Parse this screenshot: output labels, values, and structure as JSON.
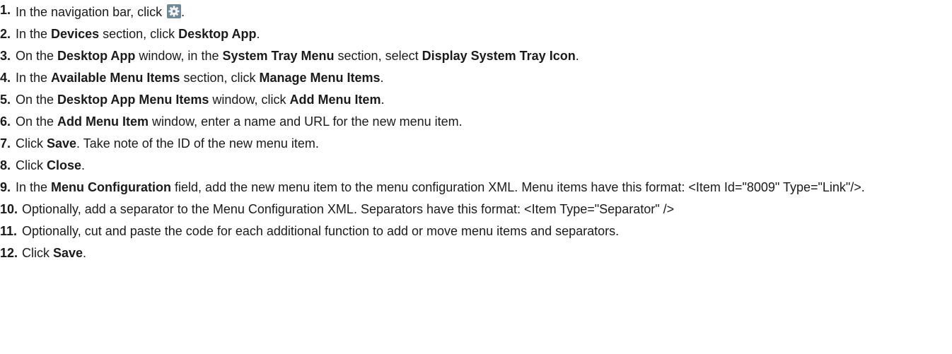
{
  "steps": [
    {
      "num": "1.",
      "segments": [
        {
          "text": "In the navigation bar, click "
        },
        {
          "icon": "gear-icon"
        },
        {
          "text": "."
        }
      ]
    },
    {
      "num": "2.",
      "segments": [
        {
          "text": "In the "
        },
        {
          "text": "Devices",
          "bold": true
        },
        {
          "text": " section, click "
        },
        {
          "text": "Desktop App",
          "bold": true
        },
        {
          "text": "."
        }
      ]
    },
    {
      "num": "3.",
      "segments": [
        {
          "text": "On the "
        },
        {
          "text": "Desktop App",
          "bold": true
        },
        {
          "text": " window, in the "
        },
        {
          "text": "System Tray Menu",
          "bold": true
        },
        {
          "text": " section, select "
        },
        {
          "text": "Display System Tray Icon",
          "bold": true
        },
        {
          "text": "."
        }
      ]
    },
    {
      "num": "4.",
      "segments": [
        {
          "text": "In the "
        },
        {
          "text": "Available Menu Items",
          "bold": true
        },
        {
          "text": " section, click "
        },
        {
          "text": "Manage Menu Items",
          "bold": true
        },
        {
          "text": "."
        }
      ]
    },
    {
      "num": "5.",
      "segments": [
        {
          "text": "On the "
        },
        {
          "text": "Desktop App Menu Items",
          "bold": true
        },
        {
          "text": " window, click "
        },
        {
          "text": "Add Menu Item",
          "bold": true
        },
        {
          "text": "."
        }
      ]
    },
    {
      "num": "6.",
      "segments": [
        {
          "text": "On the "
        },
        {
          "text": "Add Menu Item",
          "bold": true
        },
        {
          "text": " window, enter a name and URL for the new menu item."
        }
      ]
    },
    {
      "num": "7.",
      "segments": [
        {
          "text": "Click "
        },
        {
          "text": "Save",
          "bold": true
        },
        {
          "text": ". Take note of the ID of the new menu item."
        }
      ]
    },
    {
      "num": "8.",
      "segments": [
        {
          "text": "Click "
        },
        {
          "text": "Close",
          "bold": true
        },
        {
          "text": "."
        }
      ]
    },
    {
      "num": "9.",
      "wrap": true,
      "segments": [
        {
          "text": "In the "
        },
        {
          "text": "Menu Configuration",
          "bold": true
        },
        {
          "text": " field, add the new menu item to the menu configuration XML. Menu items have this format: <Item Id=\"8009\" Type=\"Link\"/>."
        }
      ]
    },
    {
      "num": "10.",
      "wrap": true,
      "segments": [
        {
          "text": "Optionally, add a separator to the Menu Configuration XML. Separators have this format: <Item Type=\"Separator\" />"
        }
      ]
    },
    {
      "num": "11.",
      "segments": [
        {
          "text": "Optionally, cut and paste the code for each additional function to add or move menu items and separators."
        }
      ]
    },
    {
      "num": "12.",
      "segments": [
        {
          "text": "Click "
        },
        {
          "text": "Save",
          "bold": true
        },
        {
          "text": "."
        }
      ]
    }
  ],
  "colors": {
    "text": "#1a1a1a",
    "gear_bg": "#6f8898",
    "gear_fg": "#f3f6f8"
  }
}
